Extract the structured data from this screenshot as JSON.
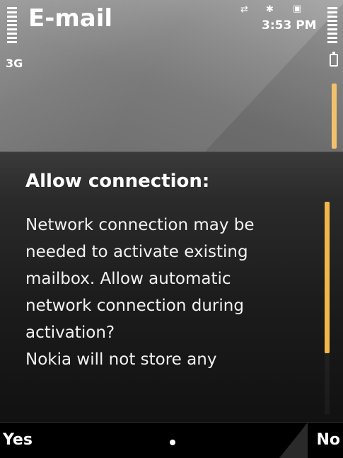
{
  "status": {
    "network": "3G",
    "time": "3:53 PM"
  },
  "app": {
    "title": "E-mail"
  },
  "dialog": {
    "title": "Allow connection:",
    "body_lines": [
      "Network connection may be",
      "needed to activate existing",
      "mailbox. Allow automatic",
      "network connection during",
      "activation?",
      "Nokia will not store any"
    ]
  },
  "softkeys": {
    "left": "Yes",
    "right": "No"
  },
  "colors": {
    "scrollbar": "#f3b64a",
    "background": "#000000"
  }
}
